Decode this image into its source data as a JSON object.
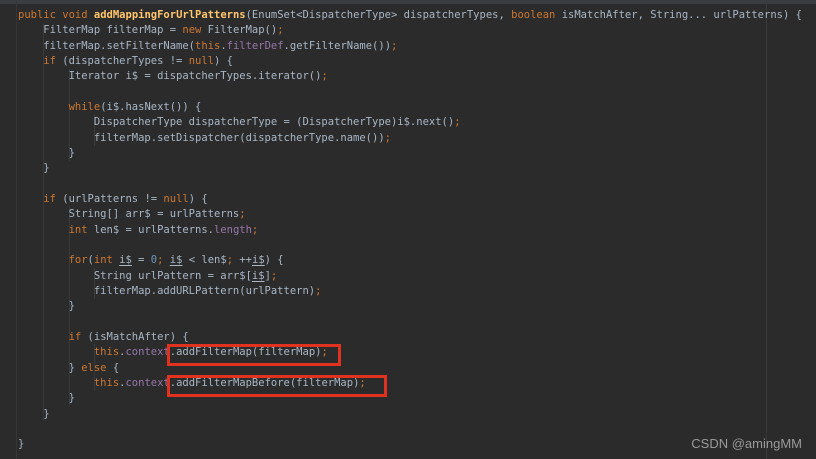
{
  "editor": {
    "colors": {
      "background": "#2b2b2b",
      "default": "#a9b7c6",
      "keyword": "#cc7832",
      "method_declaration": "#ffc66d",
      "field": "#9876aa",
      "number": "#6897bb",
      "semicolon": "#cc7832",
      "highlight_box": "#e0321f"
    },
    "code_lines": [
      [
        [
          "k",
          "public"
        ],
        [
          "d",
          " "
        ],
        [
          "k",
          "void"
        ],
        [
          "d",
          " "
        ],
        [
          "m",
          "addMappingForUrlPatterns"
        ],
        [
          "d",
          "(EnumSet<DispatcherType> dispatcherTypes, "
        ],
        [
          "k",
          "boolean"
        ],
        [
          "d",
          " isMatchAfter, String... urlPatterns) {"
        ]
      ],
      [
        [
          "d",
          "    FilterMap filterMap = "
        ],
        [
          "k",
          "new"
        ],
        [
          "d",
          " FilterMap()"
        ],
        [
          "s",
          ";"
        ]
      ],
      [
        [
          "d",
          "    filterMap.setFilterName("
        ],
        [
          "k",
          "this"
        ],
        [
          "d",
          "."
        ],
        [
          "f",
          "filterDef"
        ],
        [
          "d",
          ".getFilterName())"
        ],
        [
          "s",
          ";"
        ]
      ],
      [
        [
          "d",
          "    "
        ],
        [
          "k",
          "if"
        ],
        [
          "d",
          " (dispatcherTypes != "
        ],
        [
          "k",
          "null"
        ],
        [
          "d",
          ") {"
        ]
      ],
      [
        [
          "d",
          "        Iterator i$ = dispatcherTypes.iterator()"
        ],
        [
          "s",
          ";"
        ]
      ],
      [],
      [
        [
          "d",
          "        "
        ],
        [
          "k",
          "while"
        ],
        [
          "d",
          "(i$.hasNext()) {"
        ]
      ],
      [
        [
          "d",
          "            DispatcherType dispatcherType = (DispatcherType)i$.next()"
        ],
        [
          "s",
          ";"
        ]
      ],
      [
        [
          "d",
          "            filterMap.setDispatcher(dispatcherType.name())"
        ],
        [
          "s",
          ";"
        ]
      ],
      [
        [
          "d",
          "        }"
        ]
      ],
      [
        [
          "d",
          "    }"
        ]
      ],
      [],
      [
        [
          "d",
          "    "
        ],
        [
          "k",
          "if"
        ],
        [
          "d",
          " (urlPatterns != "
        ],
        [
          "k",
          "null"
        ],
        [
          "d",
          ") {"
        ]
      ],
      [
        [
          "d",
          "        String[] arr$ = urlPatterns"
        ],
        [
          "s",
          ";"
        ]
      ],
      [
        [
          "d",
          "        "
        ],
        [
          "k",
          "int"
        ],
        [
          "d",
          " len$ = urlPatterns."
        ],
        [
          "f",
          "length"
        ],
        [
          "s",
          ";"
        ]
      ],
      [],
      [
        [
          "d",
          "        "
        ],
        [
          "k",
          "for"
        ],
        [
          "d",
          "("
        ],
        [
          "k",
          "int"
        ],
        [
          "d",
          " "
        ],
        [
          "u",
          "i$"
        ],
        [
          "d",
          " = "
        ],
        [
          "n",
          "0"
        ],
        [
          "s",
          ";"
        ],
        [
          "d",
          " "
        ],
        [
          "u",
          "i$"
        ],
        [
          "d",
          " < len$"
        ],
        [
          "s",
          ";"
        ],
        [
          "d",
          " ++"
        ],
        [
          "u",
          "i$"
        ],
        [
          "d",
          ") {"
        ]
      ],
      [
        [
          "d",
          "            String urlPattern = arr$["
        ],
        [
          "u",
          "i$"
        ],
        [
          "d",
          "]"
        ],
        [
          "s",
          ";"
        ]
      ],
      [
        [
          "d",
          "            filterMap.addURLPattern(urlPattern)"
        ],
        [
          "s",
          ";"
        ]
      ],
      [
        [
          "d",
          "        }"
        ]
      ],
      [],
      [
        [
          "d",
          "        "
        ],
        [
          "k",
          "if"
        ],
        [
          "d",
          " (isMatchAfter) {"
        ]
      ],
      [
        [
          "d",
          "            "
        ],
        [
          "k",
          "this"
        ],
        [
          "d",
          "."
        ],
        [
          "f",
          "context"
        ],
        [
          "d",
          ".addFilterMap(filterMap)"
        ],
        [
          "s",
          ";"
        ]
      ],
      [
        [
          "d",
          "        } "
        ],
        [
          "k",
          "else"
        ],
        [
          "d",
          " {"
        ]
      ],
      [
        [
          "d",
          "            "
        ],
        [
          "k",
          "this"
        ],
        [
          "d",
          "."
        ],
        [
          "f",
          "context"
        ],
        [
          "d",
          ".addFilterMapBefore(filterMap)"
        ],
        [
          "s",
          ";"
        ]
      ],
      [
        [
          "d",
          "        }"
        ]
      ],
      [
        [
          "d",
          "    }"
        ]
      ],
      [],
      [
        [
          "d",
          "}"
        ]
      ]
    ]
  },
  "annotations": {
    "boxes": [
      {
        "highlighted_text": "addFilterMap(filterMap);"
      },
      {
        "highlighted_text": "addFilterMapBefore(filterMap);"
      }
    ]
  },
  "watermark": {
    "text": "CSDN @amingMM"
  }
}
